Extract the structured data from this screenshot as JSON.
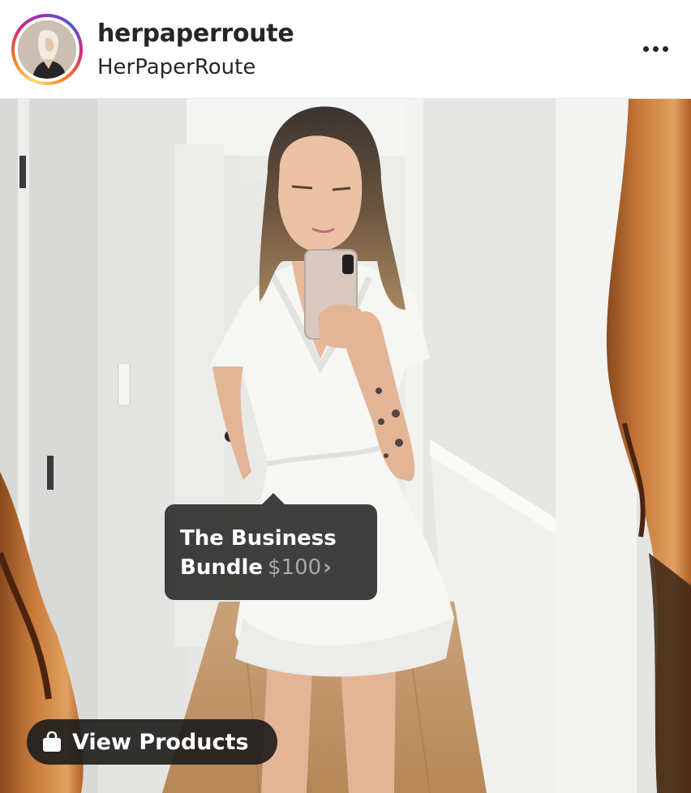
{
  "post": {
    "username": "herpaperroute",
    "subtitle": "HerPaperRoute",
    "more_icon": "more-horizontal-icon"
  },
  "product_tag": {
    "name_line1": "The Business",
    "name_line2": "Bundle",
    "price": "$100",
    "chevron": "›"
  },
  "shopping": {
    "icon": "shopping-bag-icon",
    "label": "View Products"
  },
  "colors": {
    "text": "#262626",
    "tag_background": "#262626",
    "price_grey": "#a8a8a8"
  }
}
